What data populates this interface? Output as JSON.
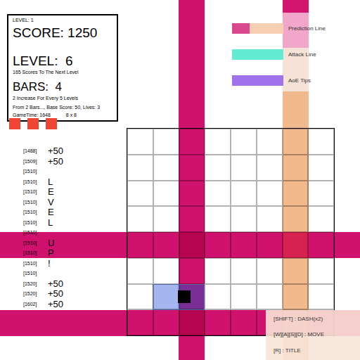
{
  "hud": {
    "title": "LEVEL: 1",
    "score": "SCORE: 1250",
    "level": "LEVEL:  6",
    "level_note": "165 Scores To The Next Level",
    "bars": "BARS:  4",
    "bars_note": "2 Increase For Every 5 Levels",
    "info": "From 2 Bars..., Base Score: 50, Lives: 3",
    "time": "GameTime: 1648",
    "size": "8 x 8"
  },
  "lives": [
    {
      "lost": false
    },
    {
      "lost": false
    },
    {
      "lost": false
    }
  ],
  "log": [
    {
      "time": "[1488]",
      "text": "+50"
    },
    {
      "time": "[1509]",
      "text": "+50"
    },
    {
      "time": "[1510]",
      "text": ""
    },
    {
      "time": "[1510]",
      "text": "L"
    },
    {
      "time": "[1510]",
      "text": "E"
    },
    {
      "time": "[1510]",
      "text": "V"
    },
    {
      "time": "[1510]",
      "text": "E"
    },
    {
      "time": "[1510]",
      "text": "L"
    },
    {
      "time": "[1510]",
      "text": ""
    },
    {
      "time": "[1510]",
      "text": "U"
    },
    {
      "time": "[1510]",
      "text": "P"
    },
    {
      "time": "[1510]",
      "text": "!"
    },
    {
      "time": "[1510]",
      "text": ""
    },
    {
      "time": "[1520]",
      "text": "+50"
    },
    {
      "time": "[1520]",
      "text": "+50"
    },
    {
      "time": "[1602]",
      "text": "+50"
    }
  ],
  "grid": {
    "rows": 8,
    "cols": 8
  },
  "bars": [
    {
      "orientation": "vertical",
      "index": 2,
      "kind": "attack",
      "color": "#d1116e"
    },
    {
      "orientation": "horizontal",
      "index": 4,
      "kind": "attack",
      "color": "#d1116e"
    },
    {
      "orientation": "horizontal",
      "index": 7,
      "kind": "attack",
      "color": "#d1116e"
    },
    {
      "orientation": "vertical",
      "index": 6,
      "kind": "prediction",
      "color": "#f2b98c"
    }
  ],
  "player": {
    "row": 6,
    "col": 2,
    "aoe": [
      1,
      2
    ]
  },
  "legend": [
    {
      "label": "Prediction Line",
      "colors": [
        "#d9478f",
        "#f6cfb2"
      ]
    },
    {
      "label": "Attack Line",
      "colors": [
        "#62ead2"
      ]
    },
    {
      "label": "AoE Tips",
      "colors": [
        "#a173ea"
      ]
    }
  ],
  "controls": [
    "[SHIFT] : DASH(x2)",
    "[W][A][S][D] : MOVE",
    "[R] : TITLE"
  ]
}
